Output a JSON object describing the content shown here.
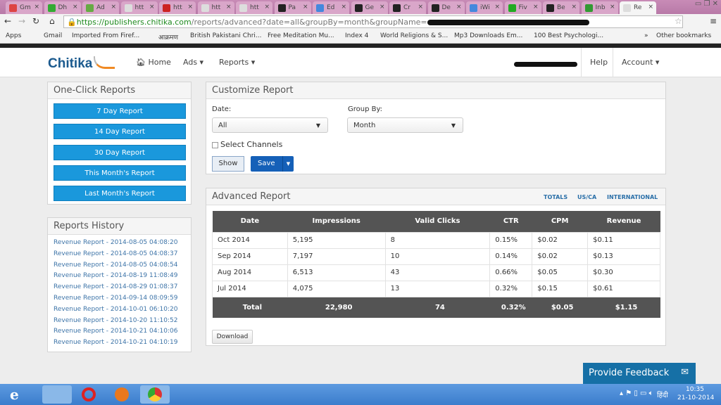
{
  "browser": {
    "tabs": [
      {
        "label": "Gm",
        "color": "#d44"
      },
      {
        "label": "Dh",
        "color": "#3a3"
      },
      {
        "label": "Ad",
        "color": "#6a4"
      },
      {
        "label": "htt",
        "color": "#ddd"
      },
      {
        "label": "htt",
        "color": "#c22"
      },
      {
        "label": "htt",
        "color": "#ddd"
      },
      {
        "label": "htt",
        "color": "#ddd"
      },
      {
        "label": "Pa",
        "color": "#222"
      },
      {
        "label": "Ed",
        "color": "#48d"
      },
      {
        "label": "Ge",
        "color": "#222"
      },
      {
        "label": "Cr",
        "color": "#222"
      },
      {
        "label": "De",
        "color": "#222"
      },
      {
        "label": "iWi",
        "color": "#48d"
      },
      {
        "label": "Fiv",
        "color": "#2a2"
      },
      {
        "label": "Be",
        "color": "#222"
      },
      {
        "label": "Inb",
        "color": "#393"
      },
      {
        "label": "Re",
        "color": "#ddd"
      }
    ],
    "url_host": "https://publishers.chitika.com",
    "url_path": "/reports/advanced?date=all&groupBy=month&groupName=",
    "bookmarks": [
      "Apps",
      "Gmail",
      "Imported From Firef...",
      "आक्रमण",
      "British Pakistani Chri...",
      "Free Meditation Mu...",
      "Index 4",
      "World Religions & S...",
      "Mp3 Downloads Em...",
      "100 Best Psychologi...",
      "»",
      "Other bookmarks"
    ]
  },
  "nav": {
    "logo": "Chitika",
    "home": "Home",
    "ads": "Ads ▾",
    "reports": "Reports ▾",
    "help": "Help",
    "account": "Account ▾"
  },
  "one_click": {
    "title": "One-Click Reports",
    "buttons": [
      "7 Day Report",
      "14 Day Report",
      "30 Day Report",
      "This Month's Report",
      "Last Month's Report"
    ]
  },
  "history": {
    "title": "Reports History",
    "items": [
      "Revenue Report - 2014-08-05 04:08:20",
      "Revenue Report - 2014-08-05 04:08:37",
      "Revenue Report - 2014-08-05 04:08:54",
      "Revenue Report - 2014-08-19 11:08:49",
      "Revenue Report - 2014-08-29 01:08:37",
      "Revenue Report - 2014-09-14 08:09:59",
      "Revenue Report - 2014-10-01 06:10:20",
      "Revenue Report - 2014-10-20 11:10:52",
      "Revenue Report - 2014-10-21 04:10:06",
      "Revenue Report - 2014-10-21 04:10:19"
    ]
  },
  "customize": {
    "title": "Customize Report",
    "date_label": "Date:",
    "date_value": "All",
    "group_label": "Group By:",
    "group_value": "Month",
    "channels": "Select Channels",
    "show": "Show",
    "save": "Save"
  },
  "advanced": {
    "title": "Advanced Report",
    "tabs": [
      "TOTALS",
      "US/CA",
      "INTERNATIONAL"
    ],
    "columns": [
      "Date",
      "Impressions",
      "Valid Clicks",
      "CTR",
      "CPM",
      "Revenue"
    ],
    "rows": [
      [
        "Oct 2014",
        "5,195",
        "8",
        "0.15%",
        "$0.02",
        "$0.11"
      ],
      [
        "Sep 2014",
        "7,197",
        "10",
        "0.14%",
        "$0.02",
        "$0.13"
      ],
      [
        "Aug 2014",
        "6,513",
        "43",
        "0.66%",
        "$0.05",
        "$0.30"
      ],
      [
        "Jul 2014",
        "4,075",
        "13",
        "0.32%",
        "$0.15",
        "$0.61"
      ]
    ],
    "total": [
      "Total",
      "22,980",
      "74",
      "0.32%",
      "$0.05",
      "$1.15"
    ],
    "download": "Download"
  },
  "feedback": "Provide Feedback",
  "taskbar": {
    "lang": "हिंदी",
    "time": "10:35",
    "date": "21-10-2014"
  }
}
